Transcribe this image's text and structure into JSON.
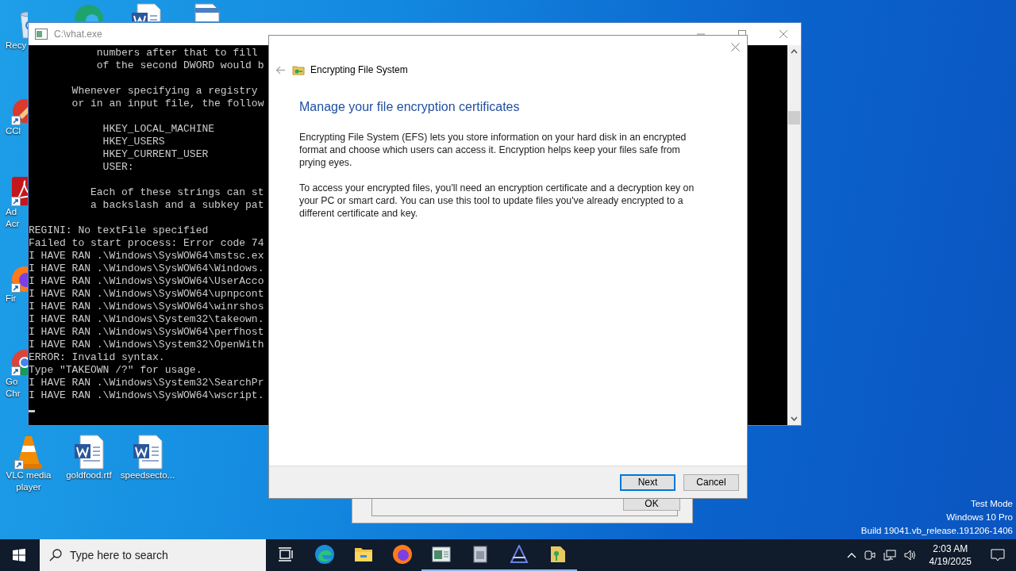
{
  "desktop_icons": [
    {
      "kind": "recycle-bin",
      "label_lines": [
        "Recy"
      ],
      "shortcut": false
    },
    {
      "kind": "ccleaner",
      "label_lines": [
        "CCl"
      ],
      "shortcut": true
    },
    {
      "kind": "acrobat",
      "label_lines": [
        "Ad",
        "Acr"
      ],
      "shortcut": true
    },
    {
      "kind": "firefox",
      "label_lines": [
        "Fir"
      ],
      "shortcut": true
    },
    {
      "kind": "chrome",
      "label_lines": [
        "Go",
        "Chr"
      ],
      "shortcut": true
    },
    {
      "kind": "vlc",
      "label_lines": [
        "VLC media",
        "player"
      ],
      "shortcut": true
    },
    {
      "kind": "word",
      "label_lines": [
        "goldfood.rtf"
      ],
      "shortcut": false
    },
    {
      "kind": "word",
      "label_lines": [
        "speedsecto..."
      ],
      "shortcut": false
    },
    {
      "kind": "edge",
      "shortcut": false
    },
    {
      "kind": "word",
      "shortcut": false
    },
    {
      "kind": "document",
      "shortcut": false
    }
  ],
  "console": {
    "title": "C:\\vhat.exe",
    "blocks": [
      {
        "kind": "help",
        "lines": [
          "           numbers after that to fill",
          "           of the second DWORD would b"
        ]
      },
      {
        "kind": "help",
        "lines": [
          "       Whenever specifying a registry",
          "       or in an input file, the follow"
        ]
      },
      {
        "kind": "help",
        "lines": [
          "            HKEY_LOCAL_MACHINE",
          "            HKEY_USERS",
          "            HKEY_CURRENT_USER",
          "            USER:"
        ]
      },
      {
        "kind": "help",
        "lines": [
          "          Each of these strings can st",
          "          a backslash and a subkey pat"
        ]
      },
      {
        "kind": "output",
        "lines": [
          "REGINI: No textFile specified",
          "Failed to start process: Error code 74",
          "I HAVE RAN .\\Windows\\SysWOW64\\mstsc.ex",
          "I HAVE RAN .\\Windows\\SysWOW64\\Windows.",
          "I HAVE RAN .\\Windows\\SysWOW64\\UserAcco",
          "I HAVE RAN .\\Windows\\SysWOW64\\upnpcont",
          "I HAVE RAN .\\Windows\\SysWOW64\\winrshos",
          "I HAVE RAN .\\Windows\\System32\\takeown.",
          "I HAVE RAN .\\Windows\\SysWOW64\\perfhost",
          "I HAVE RAN .\\Windows\\System32\\OpenWith",
          "ERROR: Invalid syntax.",
          "Type \"TAKEOWN /?\" for usage.",
          "I HAVE RAN .\\Windows\\System32\\SearchPr",
          "I HAVE RAN .\\Windows\\SysWOW64\\wscript."
        ]
      }
    ]
  },
  "back_dialog": {
    "button": "OK"
  },
  "efs_dialog": {
    "back_disabled": true,
    "title": "Encrypting File System",
    "heading": "Manage your file encryption certificates",
    "paragraphs": [
      "Encrypting File System (EFS) lets you store information on your hard disk in an encrypted format and choose which users can access it. Encryption helps keep your files safe from prying eyes.",
      "To access your encrypted files, you'll need an encryption certificate and a decryption key on your PC or smart card. You can use this tool to update files you've already encrypted to a different certificate and key."
    ],
    "buttons": [
      {
        "label": "Next",
        "default": true
      },
      {
        "label": "Cancel",
        "default": false
      }
    ]
  },
  "system_notice": [
    "Test Mode",
    "Windows 10 Pro",
    "Build 19041.vb_release.191206-1406"
  ],
  "taskbar": {
    "search": {
      "placeholder": "Type here to search"
    },
    "apps": [
      {
        "kind": "task-view",
        "running": false
      },
      {
        "kind": "edge",
        "running": false
      },
      {
        "kind": "explorer",
        "running": false
      },
      {
        "kind": "firefox",
        "running": false
      },
      {
        "kind": "app-window",
        "running": true
      },
      {
        "kind": "archive",
        "running": true
      },
      {
        "kind": "a-logo",
        "running": true
      },
      {
        "kind": "key-folder",
        "running": true
      }
    ],
    "time": "2:03 AM",
    "date": "4/19/2025"
  }
}
